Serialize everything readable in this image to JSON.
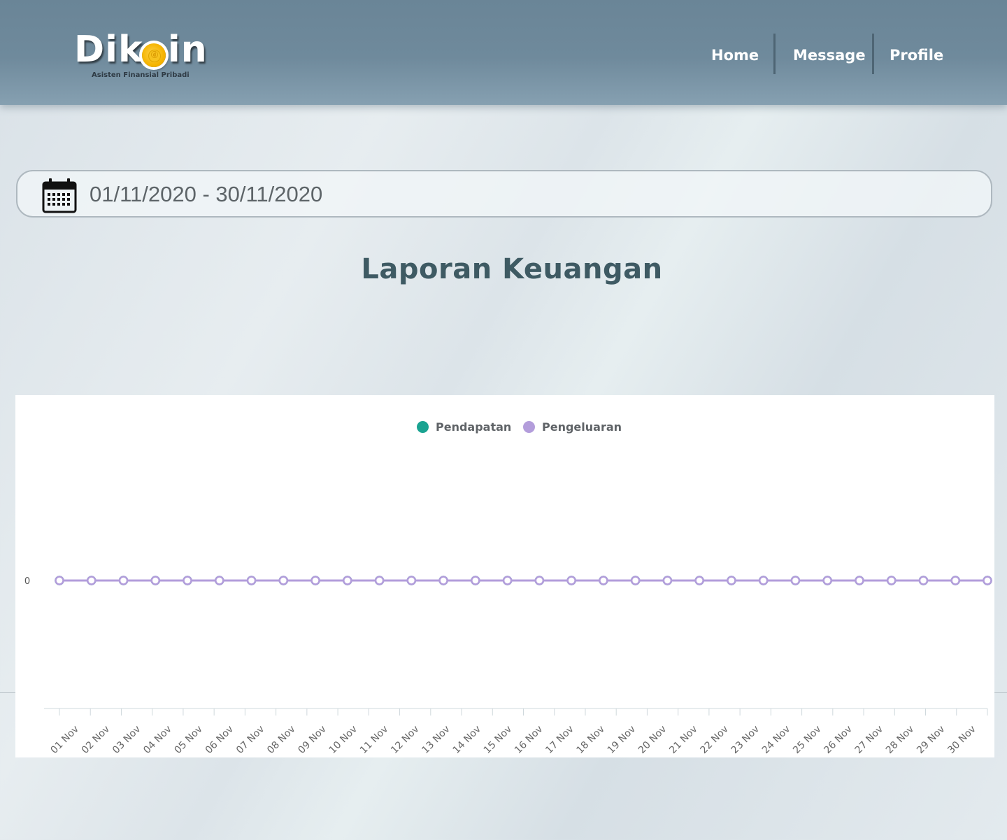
{
  "header": {
    "logo": {
      "name": "Dikoin",
      "tagline": "Asisten Finansial Pribadi"
    },
    "nav": [
      {
        "label": "Home"
      },
      {
        "label": "Message"
      },
      {
        "label": "Profile"
      }
    ]
  },
  "date_range": {
    "icon": "calendar-icon",
    "value": "01/11/2020 - 30/11/2020"
  },
  "page_title": "Laporan Keuangan",
  "chart_data": {
    "type": "line",
    "x": [
      "01 Nov",
      "02 Nov",
      "03 Nov",
      "04 Nov",
      "05 Nov",
      "06 Nov",
      "07 Nov",
      "08 Nov",
      "09 Nov",
      "10 Nov",
      "11 Nov",
      "12 Nov",
      "13 Nov",
      "14 Nov",
      "15 Nov",
      "16 Nov",
      "17 Nov",
      "18 Nov",
      "19 Nov",
      "20 Nov",
      "21 Nov",
      "22 Nov",
      "23 Nov",
      "24 Nov",
      "25 Nov",
      "26 Nov",
      "27 Nov",
      "28 Nov",
      "29 Nov",
      "30 Nov"
    ],
    "series": [
      {
        "name": "Pendapatan",
        "color": "#1aa391",
        "values": [
          0,
          0,
          0,
          0,
          0,
          0,
          0,
          0,
          0,
          0,
          0,
          0,
          0,
          0,
          0,
          0,
          0,
          0,
          0,
          0,
          0,
          0,
          0,
          0,
          0,
          0,
          0,
          0,
          0,
          0
        ]
      },
      {
        "name": "Pengeluaran",
        "color": "#b39ddb",
        "values": [
          0,
          0,
          0,
          0,
          0,
          0,
          0,
          0,
          0,
          0,
          0,
          0,
          0,
          0,
          0,
          0,
          0,
          0,
          0,
          0,
          0,
          0,
          0,
          0,
          0,
          0,
          0,
          0,
          0,
          0
        ]
      }
    ],
    "yticks": [
      "0"
    ],
    "legend_position": "top-center",
    "grid": false
  }
}
